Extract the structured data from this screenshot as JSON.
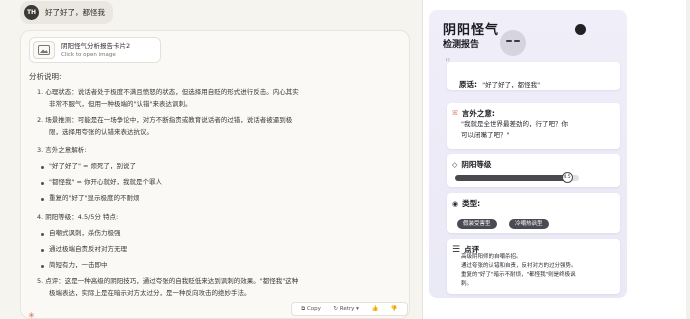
{
  "user": {
    "avatar": "TH",
    "message": "好了好了，都怪我"
  },
  "artifact": {
    "title": "阴阳怪气分析报告卡片2",
    "subtitle": "Click to open image"
  },
  "analysis": {
    "heading": "分析说明:",
    "lines": [
      "1. 心理状态：说话者处于极度不满且愤怒的状态，但选择用自贬的形式进行反击。内心其实",
      "非常不服气，但用一种极端的\"认错\"来表达讽刺。",
      "2. 场景推测：可能是在一场争论中，对方不断指责或教育说话者的过错，说话者被逼到极",
      "限，选择用夸张的认错来表达抗议。",
      "3. 言外之意解析:",
      "\"好了好了\" = 烦死了，别说了",
      "\"都怪我\" = 你开心就好，我就是个罪人",
      "重复的\"好了\"显示极度的不耐烦",
      "4. 阴阳等级：4.5/5分 特点:",
      "自嘲式讽刺，杀伤力极强",
      "通过极端自责反衬对方无理",
      "简短有力，一击即中",
      "5. 点评：这是一种高级的阴阳技巧，通过夸张的自我贬低来达到讽刺的效果。\"都怪我\"这种",
      "极端表达，实际上是在暗示对方太过分，是一种反向攻击的绝妙手法。"
    ]
  },
  "actions": {
    "copy": "Copy",
    "retry": "Retry",
    "like": "👍",
    "dislike": "👎",
    "menu": "⋯"
  },
  "card": {
    "title": "阴阳怪气",
    "subtitle": "检测报告",
    "quote_mark": "\"",
    "original_label": "原话:",
    "original_text": "\"好了好了，都怪我\"",
    "hidden_label": "言外之意:",
    "hidden_text_1": "\"我就是全世界最差劲的，行了吧？你",
    "hidden_text_2": "可以闭嘴了吧？\"",
    "level_label": "阴阳等级",
    "level_value": "4.5",
    "level_fraction": 0.9,
    "type_label": "类型:",
    "tags": [
      "假装受害型",
      "冷嘲热讽型"
    ],
    "comment_label": "点评",
    "comment_lines": [
      "高级阴阳师的自嘲杀招。",
      "通过夸张的认错和自责，反衬对方的过分强势。",
      "重复的\"好了\"暗示不耐烦，\"都怪我\"则是终极讽",
      "刺。"
    ],
    "accent": "#e07a6a"
  }
}
